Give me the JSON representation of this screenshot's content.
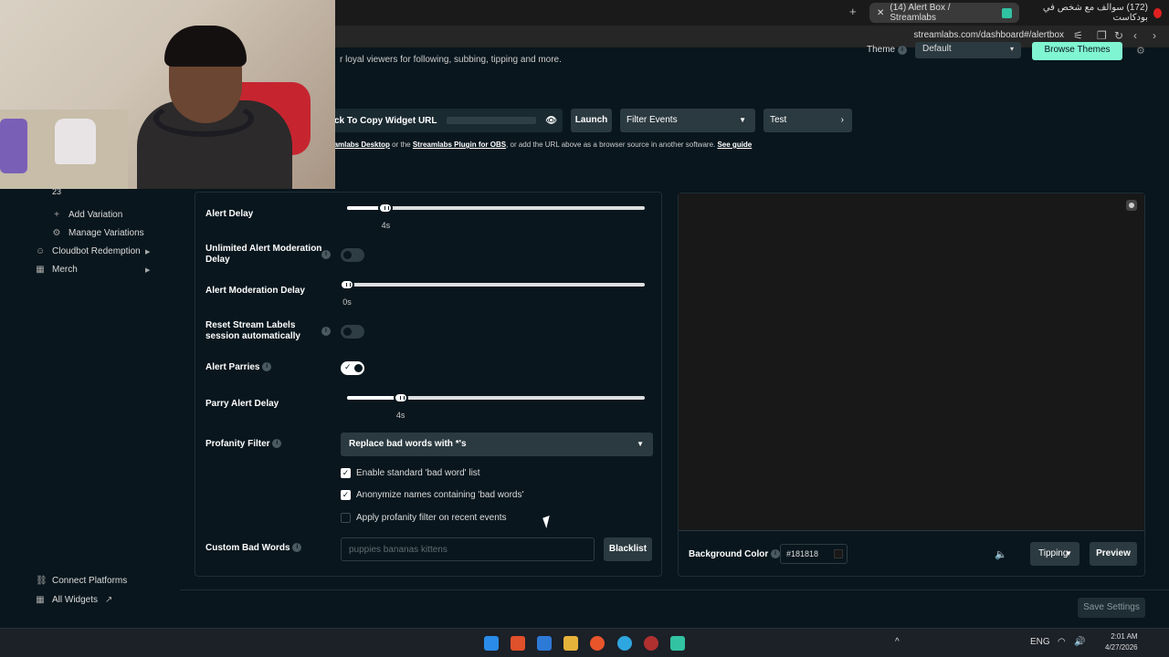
{
  "browser": {
    "active_tab": "(14) Alert Box / Streamlabs",
    "other_tab": "(172) سوالف مع شخص في بودكاست",
    "url": "streamlabs.com/dashboard#/alertbox"
  },
  "header": {
    "description": "r loyal viewers for following, subbing, tipping and more.",
    "theme_label": "Theme",
    "theme_value": "Default",
    "browse_themes": "Browse Themes",
    "widget_url_label": "ck To Copy Widget URL",
    "launch": "Launch",
    "filter_events": "Filter Events",
    "test": "Test",
    "help_link1": "reamlabs Desktop",
    "help_mid1": " or the ",
    "help_link2": "Streamlabs Plugin for OBS",
    "help_mid2": ", or add the URL above as a browser source in another software. ",
    "help_link3": "See guide"
  },
  "sidebar": {
    "count": "23",
    "items": [
      {
        "label": "Add Variation",
        "icon": "+"
      },
      {
        "label": "Manage Variations",
        "icon": "⚙"
      },
      {
        "label": "Cloudbot Redemption",
        "icon": "☺"
      },
      {
        "label": "Merch",
        "icon": "▦"
      },
      {
        "label": "Connect Platforms",
        "icon": "⛓"
      },
      {
        "label": "All Widgets",
        "icon": "▦"
      }
    ]
  },
  "settings": {
    "alert_delay": {
      "label": "Alert Delay",
      "value": "4s",
      "level": 0.13
    },
    "unlimited_mod_delay": {
      "label": "Unlimited Alert Moderation Delay",
      "on": false
    },
    "mod_delay": {
      "label": "Alert Moderation Delay",
      "value": "0s",
      "level": 0.0
    },
    "reset_labels": {
      "label": "Reset Stream Labels session automatically",
      "on": false
    },
    "alert_parries": {
      "label": "Alert Parries",
      "on": true
    },
    "parry_delay": {
      "label": "Parry Alert Delay",
      "value": "4s",
      "level": 0.18
    },
    "profanity": {
      "label": "Profanity Filter",
      "value": "Replace bad words with *'s"
    },
    "checkboxes": [
      {
        "label": "Enable standard 'bad word' list",
        "checked": true
      },
      {
        "label": "Anonymize names containing 'bad words'",
        "checked": true
      },
      {
        "label": "Apply profanity filter on recent events",
        "checked": false
      }
    ],
    "custom_bad_words": {
      "label": "Custom Bad Words",
      "placeholder": "puppies bananas kittens"
    },
    "blacklist": "Blacklist"
  },
  "preview": {
    "bg_label": "Background Color",
    "bg_value": "#181818",
    "tipping": "Tipping",
    "preview_btn": "Preview"
  },
  "footer": {
    "save": "Save Settings"
  },
  "taskbar": {
    "lang": "ENG",
    "time": "2:01 AM",
    "date": "4/27/2026"
  },
  "colors": {
    "accent": "#80f5d2",
    "background": "#09161d",
    "surface": "#2b3a40"
  }
}
